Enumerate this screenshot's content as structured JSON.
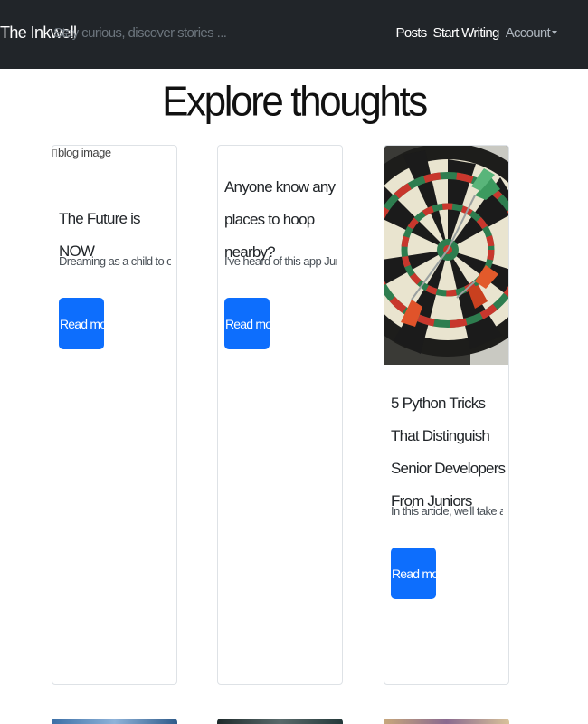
{
  "navbar": {
    "brand": "The Inkwell",
    "tagline": "Stay curious, discover stories ...",
    "links": [
      {
        "label": "Posts"
      },
      {
        "label": "Start Writing"
      },
      {
        "label": "Account"
      }
    ]
  },
  "page_title": "Explore thoughts",
  "posts": [
    {
      "image_alt": "blog image",
      "title": "The Future is NOW",
      "excerpt": "Dreaming as a child to one day wave",
      "button_label": "Read more"
    },
    {
      "title": "Anyone know any places to hoop nearby?",
      "excerpt": "I've heard of this app Jumpball that",
      "button_label": "Read more"
    },
    {
      "image": "dartboard-image",
      "title": "5 Python Tricks That Distinguish Senior Developers From Juniors",
      "excerpt": "In this article, we'll take a look at five",
      "button_label": "Read more"
    }
  ],
  "colors": {
    "navbar_bg": "#212529",
    "primary_button": "#0d6efd"
  }
}
